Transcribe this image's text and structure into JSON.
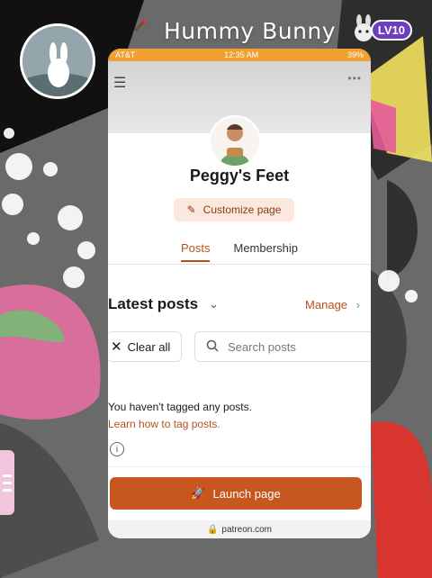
{
  "stream_overlay": {
    "streamer_name": "Hummy Bunny",
    "level_badge": "LV10",
    "bunny_icon": "bunny-icon",
    "profile_avatar": "avatar"
  },
  "phone": {
    "status_bar": {
      "carrier": "AT&T",
      "time": "12:35 AM",
      "battery": "39%"
    },
    "nav": {
      "menu_icon": "hamburger-menu-icon",
      "more_icon": "more-dots-icon"
    },
    "creator": {
      "page_title": "Peggy's Feet",
      "customize_label": "Customize page"
    },
    "tabs": [
      {
        "label": "Posts"
      },
      {
        "label": "Membership"
      }
    ],
    "posts": {
      "heading": "Latest posts",
      "manage_label": "Manage",
      "clear_all_label": "Clear all",
      "search_placeholder": "Search posts",
      "empty_message": "You haven't tagged any posts.",
      "learn_link": "Learn how to tag posts."
    },
    "launch_label": "Launch page",
    "url": "patreon.com"
  },
  "colors": {
    "accent": "#c8571f",
    "status_bar": "#f0a030",
    "customize_bg": "#fbe8dd",
    "level_badge": "#6b3fbf"
  }
}
